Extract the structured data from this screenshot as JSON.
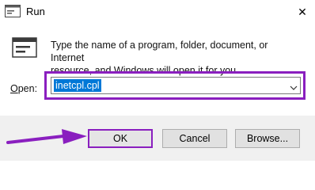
{
  "window": {
    "title": "Run",
    "close_symbol": "✕"
  },
  "icons": {
    "app": "run-app-icon",
    "run": "run-dialog-icon",
    "close": "close-icon",
    "dropdown": "chevron-down-icon",
    "pointer": "annotation-arrow-icon"
  },
  "description": {
    "line1": "Type the name of a program, folder, document, or Internet",
    "line2": "resource, and Windows will open it for you."
  },
  "open_field": {
    "label_prefix": "O",
    "label_rest": "pen:",
    "value": "inetcpl.cpl"
  },
  "buttons": {
    "ok": "OK",
    "cancel": "Cancel",
    "browse": "Browse..."
  },
  "colors": {
    "highlight": "#8a1fbf",
    "selection": "#0078d7",
    "footer_bg": "#f0f0f0"
  }
}
